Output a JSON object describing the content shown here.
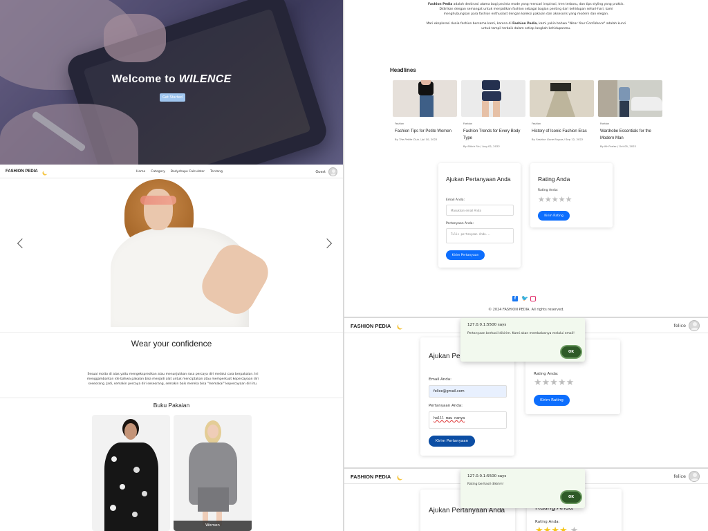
{
  "hero": {
    "title_prefix": "Welcome to ",
    "title_brand": "WILENCE",
    "button": "Get Started"
  },
  "nav": {
    "brand": "FASHION PEDIA",
    "links": [
      "Home",
      "Category",
      "Bodyshape Calculator",
      "Tentang"
    ],
    "user": "Guest"
  },
  "section": {
    "title": "Wear your confidence",
    "text": "Sesuai motto di atas yaitu mengekspresikan atau menunjukkan rasa percaya diri melalui cara berpakaian. Ini menggambarkan ide bahwa pakaian bisa menjadi alat untuk menciptakan atau memperkuat kepercayaan diri seseorang. Jadi, semakin percaya diri seseorang, semakin baik mereka bisa \"memakai\" kepercayaan diri itu."
  },
  "catalog": {
    "title": "Buku Pakaian",
    "cards": [
      {
        "label": ""
      },
      {
        "label": "Women"
      }
    ]
  },
  "about": {
    "brand": "Fashion Pedia",
    "text1": " adalah destinasi utama bagi pecinta mode yang mencari inspirasi, tren terbaru, dan tips styling yang praktis. Didirikan dengan semangat untuk menjadikan fashion sebagai bagian penting dari kehidupan sehari-hari, kami menghubungkan para fashion enthusiast dengan koleksi pakaian dan aksesoris yang modern dan elegan.",
    "text2a": "Mari eksplorasi dunia fashion bersama kami, karena di ",
    "text2b": ", kami yakin bahwa ",
    "motto": "\"Wear Your Confidence\"",
    "text2c": " adalah kunci untuk tampil terbaik dalam setiap langkah kehidupanmu."
  },
  "headlines": {
    "title": "Headlines",
    "items": [
      {
        "tag": "Fashion",
        "title": "Fashion Tips for Petite Women",
        "by": "By ",
        "author": "The Petite Club",
        "date": " / Jul 10, 2022"
      },
      {
        "tag": "Fashion",
        "title": "Fashion Trends for Every Body Type",
        "by": "By ",
        "author": "Stitch Fix",
        "date": " / Aug 02, 2022"
      },
      {
        "tag": "Fashion",
        "title": "History of Iconic Fashion Eras",
        "by": "By ",
        "author": "Fashion Gone Rogue",
        "date": " / Sep 12, 2022"
      },
      {
        "tag": "Fashion",
        "title": "Wardrobe Essentials for the Modern Man",
        "by": "By ",
        "author": "Mr Porter",
        "date": " / Oct 05, 2022"
      }
    ]
  },
  "question_form": {
    "title": "Ajukan Pertanyaan Anda",
    "email_label": "Email Anda:",
    "email_placeholder": "Masukkan email Anda",
    "question_label": "Pertanyaan Anda:",
    "question_placeholder": "Tulis pertanyaan Anda...",
    "submit": "Kirim Pertanyaan"
  },
  "rating_form": {
    "title": "Rating Anda",
    "label": "Rating Anda:",
    "stars": "★★★★★",
    "submit": "Kirim Rating"
  },
  "footer": {
    "copyright": "© 2024 FASHION PEDIA. All rights reserved."
  },
  "screen2": {
    "user": "felice",
    "email_value": "felice@gmail.com",
    "question_value": "halll mau nanya",
    "alert_title": "127.0.0.1:5500 says",
    "alert_msg": "Pertanyaan berhasil dikirim. Kami akan membalasnya melalui email!",
    "ok": "OK"
  },
  "screen3": {
    "user": "felice",
    "alert_title": "127.0.0.1:5500 says",
    "alert_msg": "Rating berhasil dikirim!",
    "ok": "OK",
    "stars_filled": "★★★★",
    "stars_empty": "★"
  },
  "colors": {
    "primary": "#0d6efd",
    "dark_button": "#0c4ea4",
    "alert_bg": "#f2f9ee",
    "ok_button": "#2e5a27",
    "star_filled": "#f5c518"
  }
}
